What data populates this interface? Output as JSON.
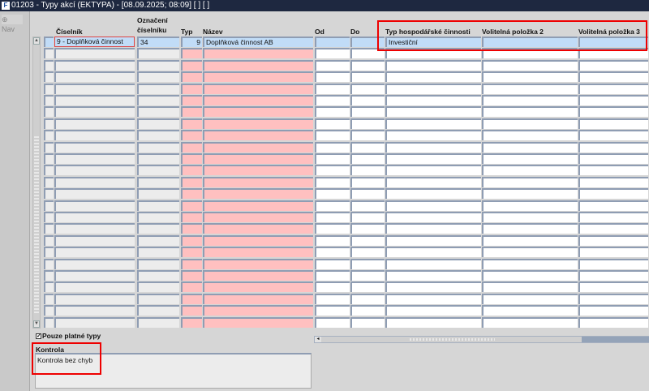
{
  "window": {
    "title": "01203 - Typy akcí (EKTYPA) - [08.09.2025; 08:09]  [ ]  [ ]",
    "icon": "app-icon"
  },
  "sidebar": {
    "nav_label": "Nav"
  },
  "table": {
    "columns": [
      {
        "key": "ciselnik",
        "label": "Číselník"
      },
      {
        "key": "oznaceni",
        "label": "Označení číselníku",
        "line1": "Označení",
        "line2": "číselníku"
      },
      {
        "key": "typ",
        "label": "Typ"
      },
      {
        "key": "nazev",
        "label": "Název"
      },
      {
        "key": "od",
        "label": "Od"
      },
      {
        "key": "do",
        "label": "Do"
      },
      {
        "key": "typ_hosp",
        "label": "Typ hospodářské činnosti"
      },
      {
        "key": "vol2",
        "label": "Volitelná položka 2"
      },
      {
        "key": "vol3",
        "label": "Volitelná položka 3"
      }
    ],
    "rows": [
      {
        "ciselnik": "9 - Doplňková činnost",
        "oznaceni": "34",
        "typ": "9",
        "nazev": "Doplňková činnost AB",
        "od": "",
        "do": "",
        "typ_hosp": "Investiční",
        "vol2": "",
        "vol3": ""
      }
    ],
    "empty_rows": 24
  },
  "filter": {
    "label": "Pouze platné typy",
    "checked": true
  },
  "kontrola": {
    "label": "Kontrola",
    "value": "Kontrola bez chyb"
  },
  "colors": {
    "title_bar": "#1e2840",
    "current_row": "#c1dcf7",
    "required_field": "#ffc0c0",
    "annotation": "#e00000"
  }
}
